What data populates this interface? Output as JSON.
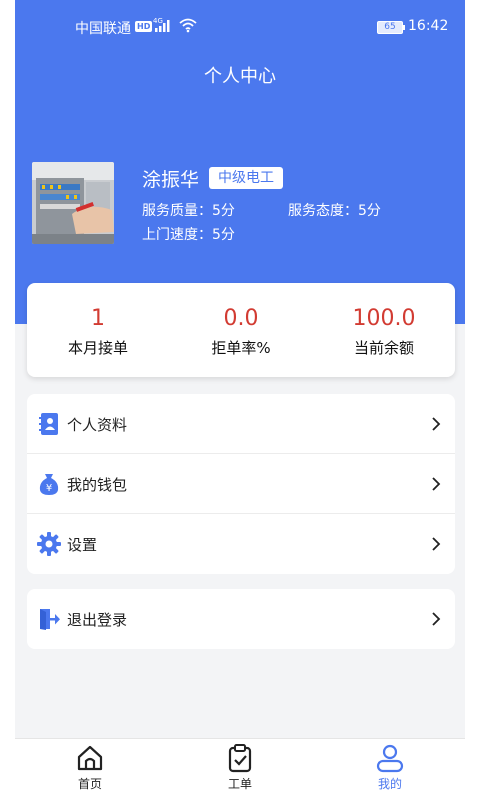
{
  "status_bar": {
    "carrier": "中国联通",
    "hd": "HD",
    "network": "4G",
    "battery": "65",
    "time": "16:42"
  },
  "header": {
    "title": "个人中心"
  },
  "profile": {
    "name": "涂振华",
    "level": "中级电工",
    "service_quality": "服务质量：5分",
    "service_attitude": "服务态度：5分",
    "visit_speed": "上门速度：5分"
  },
  "stats": [
    {
      "value": "1",
      "label": "本月接单"
    },
    {
      "value": "0.0",
      "label": "拒单率%"
    },
    {
      "value": "100.0",
      "label": "当前余额"
    }
  ],
  "menu": [
    {
      "label": "个人资料",
      "icon": "profile-book-icon"
    },
    {
      "label": "我的钱包",
      "icon": "money-bag-icon"
    },
    {
      "label": "设置",
      "icon": "gear-icon"
    }
  ],
  "logout": {
    "label": "退出登录",
    "icon": "logout-door-icon"
  },
  "tabbar": {
    "items": [
      {
        "label": "首页",
        "icon": "home-icon",
        "active": false
      },
      {
        "label": "工单",
        "icon": "clipboard-check-icon",
        "active": false
      },
      {
        "label": "我的",
        "icon": "user-icon",
        "active": true
      }
    ]
  },
  "colors": {
    "primary": "#4b78ee",
    "stat_value": "#d23b32",
    "background": "#f3f4f6"
  }
}
